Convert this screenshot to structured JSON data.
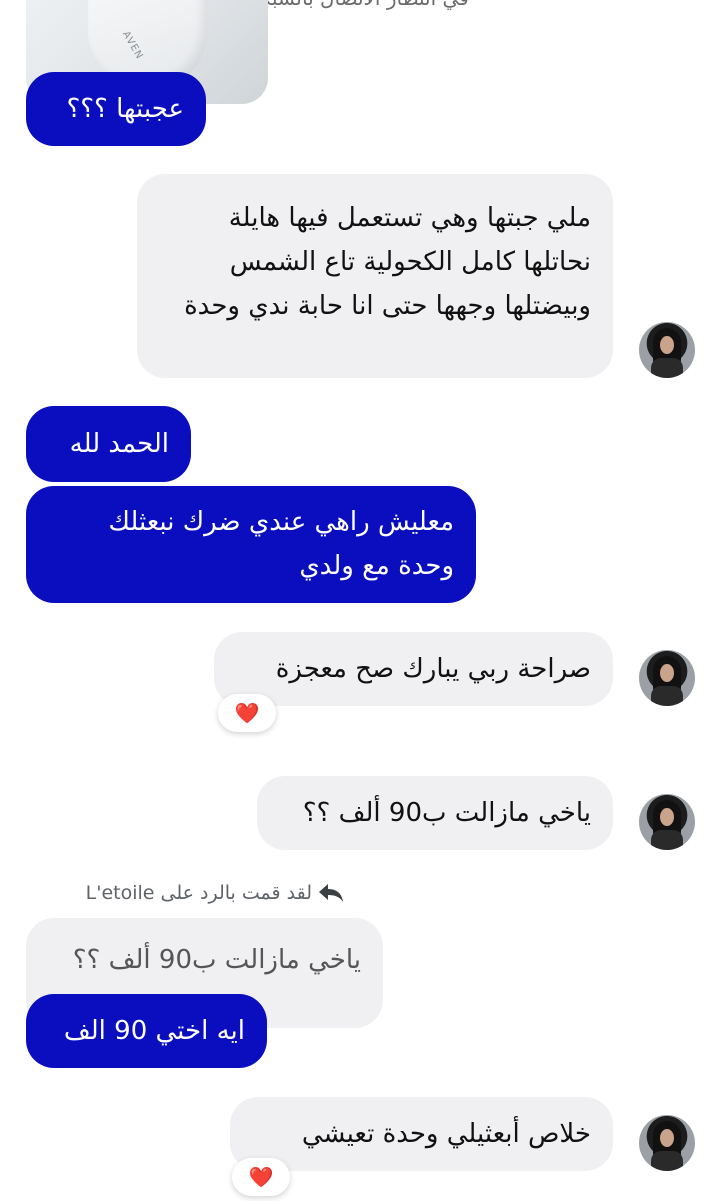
{
  "header": {
    "hint": "في انتظار الاتصال بالشبكة"
  },
  "shared_image": {
    "label": "AVEN"
  },
  "messages": [
    {
      "text": "عجبتها ؟؟؟"
    },
    {
      "text": "ملي جبتها وهي تستعمل فيها هايلة نحاتلها كامل الكحولية تاع الشمس وبيضتلها وجهها حتى انا حابة ندي وحدة"
    },
    {
      "text": "الحمد لله"
    },
    {
      "text": "معليش راهي عندي ضرك نبعثلك وحدة مع ولدي"
    },
    {
      "text": "صراحة ربي يبارك صح معجزة",
      "reaction": "❤️"
    },
    {
      "text": "ياخي مازالت ب90 ألف ؟؟"
    },
    {
      "reply_note": "لقد قمت بالرد على L'etoile",
      "quoted_text": "ياخي مازالت ب90 ألف ؟؟",
      "text": "ايه اختي 90 الف"
    },
    {
      "text": "خلاص أبعثيلي وحدة تعيشي",
      "reaction": "❤️"
    }
  ],
  "icons": {
    "reply": "reply-arrow-icon",
    "reaction": "heart-icon",
    "avatar": "contact-avatar"
  },
  "colors": {
    "outgoing_bubble": "#0a0ebf",
    "incoming_bubble": "#f0f0f3",
    "reaction_heart": "#e0182d"
  }
}
